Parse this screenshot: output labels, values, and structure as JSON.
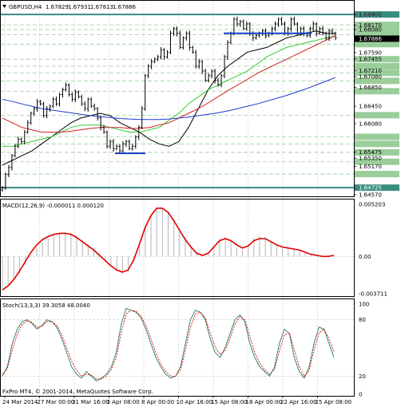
{
  "chart_data": [
    {
      "type": "line",
      "panel": "price",
      "header": {
        "symbol": "GBPUSD,H4",
        "open": "1.67829",
        "high": "1.67931",
        "low": "1.67813",
        "close": "1.67886"
      },
      "symbol_icon": "triangle-down-icon",
      "ylim": [
        1.6457,
        1.6864
      ],
      "price_ticks": [
        "1.68400",
        "1.68170",
        "1.68080",
        "1.67590",
        "1.67455",
        "1.67210",
        "1.67080",
        "1.66850",
        "1.66450",
        "1.66080",
        "1.65475",
        "1.65350",
        "1.65170",
        "1.64570"
      ],
      "highlighted_levels": [
        {
          "value": 1.684,
          "label": "1.68400",
          "color": "#3a8c7f"
        },
        {
          "value": 1.6818,
          "label": "",
          "color": "#9acd9a"
        },
        {
          "value": 1.6808,
          "label": "",
          "color": "#9acd9a"
        },
        {
          "value": 1.6797,
          "label": "",
          "color": "#9acd9a"
        },
        {
          "value": 1.6777,
          "label": "",
          "color": "#9acd9a"
        },
        {
          "value": 1.6745,
          "label": "",
          "color": "#9acd9a"
        },
        {
          "value": 1.673,
          "label": "",
          "color": "#9acd9a"
        },
        {
          "value": 1.6716,
          "label": "",
          "color": "#9acd9a"
        },
        {
          "value": 1.6699,
          "label": "",
          "color": "#9acd9a"
        },
        {
          "value": 1.6677,
          "label": "",
          "color": "#9acd9a"
        },
        {
          "value": 1.6626,
          "label": "",
          "color": "#9acd9a"
        },
        {
          "value": 1.658,
          "label": "",
          "color": "#9acd9a"
        },
        {
          "value": 1.6565,
          "label": "",
          "color": "#9acd9a"
        },
        {
          "value": 1.6547,
          "label": "",
          "color": "#9acd9a"
        },
        {
          "value": 1.6527,
          "label": "",
          "color": "#9acd9a"
        },
        {
          "value": 1.6501,
          "label": "",
          "color": "#9acd9a"
        },
        {
          "value": 1.6472,
          "label": "1.64725",
          "color": "#3a8c7f"
        }
      ],
      "current_price": {
        "value": 1.67886,
        "label": "1.67886"
      },
      "support_lines": [
        {
          "x_from": 118,
          "x_to": 140,
          "value": 1.6545
        },
        {
          "x_from": 254,
          "x_to": 348,
          "value": 1.68
        }
      ],
      "close_series": [
        1.6472,
        1.65,
        1.6515,
        1.654,
        1.656,
        1.6575,
        1.657,
        1.659,
        1.661,
        1.663,
        1.664,
        1.6655,
        1.665,
        1.6625,
        1.664,
        1.6645,
        1.666,
        1.665,
        1.667,
        1.668,
        1.669,
        1.667,
        1.666,
        1.6675,
        1.6665,
        1.665,
        1.664,
        1.666,
        1.6645,
        1.664,
        1.662,
        1.66,
        1.659,
        1.656,
        1.657,
        1.6555,
        1.656,
        1.655,
        1.6565,
        1.657,
        1.6555,
        1.656,
        1.658,
        1.66,
        1.664,
        1.671,
        1.673,
        1.674,
        1.6745,
        1.675,
        1.6765,
        1.675,
        1.676,
        1.68,
        1.681,
        1.68,
        1.677,
        1.679,
        1.68,
        1.677,
        1.676,
        1.673,
        1.674,
        1.672,
        1.67,
        1.671,
        1.672,
        1.67,
        1.669,
        1.671,
        1.675,
        1.678,
        1.68,
        1.683,
        1.682,
        1.6825,
        1.681,
        1.682,
        1.68,
        1.679,
        1.6795,
        1.68,
        1.6805,
        1.6795,
        1.68,
        1.681,
        1.682,
        1.683,
        1.682,
        1.68,
        1.681,
        1.683,
        1.682,
        1.68,
        1.681,
        1.68,
        1.6795,
        1.681,
        1.682,
        1.68,
        1.681,
        1.68,
        1.679,
        1.6805,
        1.68,
        1.679
      ],
      "ma_series": [
        {
          "color": "#000000",
          "values": [
            1.652,
            1.653,
            1.654,
            1.655,
            1.6565,
            1.658,
            1.6595,
            1.661,
            1.662,
            1.6625,
            1.663,
            1.6625,
            1.661,
            1.66,
            1.659,
            1.6575,
            1.6565,
            1.656,
            1.657,
            1.66,
            1.664,
            1.668,
            1.671,
            1.673,
            1.6745,
            1.676,
            1.6765,
            1.677,
            1.678,
            1.679,
            1.6795,
            1.68,
            1.6805,
            1.68,
            1.68
          ]
        },
        {
          "color": "#33cc33",
          "values": [
            1.656,
            1.656,
            1.6565,
            1.657,
            1.6575,
            1.658,
            1.659,
            1.66,
            1.6605,
            1.6605,
            1.6605,
            1.66,
            1.6595,
            1.659,
            1.659,
            1.6595,
            1.66,
            1.6615,
            1.663,
            1.665,
            1.6665,
            1.668,
            1.669,
            1.67,
            1.671,
            1.672,
            1.6735,
            1.675,
            1.676,
            1.677,
            1.6775,
            1.678,
            1.6785,
            1.679,
            1.6795
          ]
        },
        {
          "color": "#d02020",
          "values": [
            1.662,
            1.661,
            1.66,
            1.6595,
            1.659,
            1.659,
            1.659,
            1.6592,
            1.6595,
            1.6598,
            1.66,
            1.66,
            1.66,
            1.6598,
            1.6598,
            1.66,
            1.6605,
            1.661,
            1.662,
            1.663,
            1.664,
            1.6652,
            1.6665,
            1.6678,
            1.669,
            1.6702,
            1.6715,
            1.6725,
            1.6735,
            1.6745,
            1.6755,
            1.6765,
            1.6775,
            1.6785,
            1.6795
          ]
        },
        {
          "color": "#1a3ccf",
          "values": [
            1.666,
            1.6655,
            1.665,
            1.6645,
            1.664,
            1.6637,
            1.6634,
            1.6631,
            1.6628,
            1.6625,
            1.6623,
            1.6621,
            1.6619,
            1.6618,
            1.6617,
            1.6617,
            1.6617,
            1.6618,
            1.662,
            1.6622,
            1.6625,
            1.6628,
            1.6631,
            1.6635,
            1.664,
            1.6645,
            1.665,
            1.6656,
            1.6662,
            1.6668,
            1.6675,
            1.6682,
            1.669,
            1.6698,
            1.6706
          ]
        }
      ]
    },
    {
      "type": "bar",
      "panel": "macd",
      "title": "MACD(12,26,9) -0.000011 0.000120",
      "ylim": [
        -0.00371,
        0.00528
      ],
      "ticks": [
        "0.005203",
        "0.00",
        "-0.003711"
      ],
      "histogram": [
        -0.003,
        -0.0027,
        -0.0022,
        -0.0016,
        -0.0008,
        0.0,
        0.0008,
        0.0014,
        0.0018,
        0.002,
        0.0022,
        0.0023,
        0.0022,
        0.002,
        0.0016,
        0.0012,
        0.0008,
        0.0003,
        -0.0003,
        -0.0008,
        -0.0013,
        -0.0016,
        -0.0015,
        -0.0005,
        0.001,
        0.0028,
        0.004,
        0.0046,
        0.0047,
        0.0043,
        0.0036,
        0.0027,
        0.0018,
        0.001,
        0.0004,
        0.0001,
        0.0003,
        0.001,
        0.0017,
        0.0019,
        0.0014,
        0.0008,
        0.0006,
        0.0012,
        0.0018,
        0.002,
        0.0019,
        0.0015,
        0.001,
        0.0008,
        0.0007,
        0.0008,
        0.0006,
        0.0004,
        0.0002,
        0.0001,
        0.0,
        -0.0001,
        0.0
      ],
      "signal": [
        -0.0032,
        -0.0028,
        -0.0022,
        -0.0014,
        -0.0005,
        0.0004,
        0.0011,
        0.0016,
        0.0019,
        0.0021,
        0.0022,
        0.0022,
        0.0021,
        0.0018,
        0.0014,
        0.001,
        0.0006,
        0.0001,
        -0.0004,
        -0.0009,
        -0.0013,
        -0.0015,
        -0.0013,
        -0.0003,
        0.0012,
        0.0028,
        0.0039,
        0.0046,
        0.0046,
        0.0042,
        0.0034,
        0.0025,
        0.0016,
        0.0009,
        0.0003,
        0.0001,
        0.0003,
        0.0009,
        0.0015,
        0.0017,
        0.0015,
        0.0011,
        0.0008,
        0.001,
        0.0015,
        0.0017,
        0.0017,
        0.0014,
        0.0011,
        0.0009,
        0.0008,
        0.0007,
        0.0006,
        0.0004,
        0.0002,
        0.0001,
        0.0,
        0.0,
        0.0001
      ]
    },
    {
      "type": "line",
      "panel": "stochastic",
      "title": "Stoch(13,3,3) 39.3058 48.0040",
      "ylim": [
        0,
        100
      ],
      "ticks": [
        "100",
        "80",
        "20",
        "0"
      ],
      "main": [
        20,
        30,
        55,
        70,
        78,
        80,
        76,
        70,
        74,
        80,
        78,
        72,
        60,
        45,
        30,
        22,
        18,
        25,
        20,
        15,
        18,
        22,
        30,
        45,
        75,
        92,
        90,
        88,
        82,
        70,
        55,
        40,
        30,
        22,
        18,
        20,
        30,
        55,
        80,
        90,
        88,
        80,
        60,
        45,
        40,
        50,
        65,
        80,
        85,
        78,
        55,
        40,
        30,
        25,
        20,
        30,
        55,
        70,
        65,
        40,
        25,
        18,
        30,
        55,
        72,
        70,
        55,
        40
      ],
      "signal": [
        22,
        28,
        48,
        65,
        75,
        79,
        77,
        72,
        73,
        78,
        78,
        74,
        64,
        50,
        36,
        26,
        20,
        22,
        21,
        17,
        17,
        20,
        27,
        40,
        66,
        86,
        90,
        89,
        84,
        74,
        60,
        45,
        33,
        25,
        20,
        20,
        27,
        48,
        72,
        86,
        88,
        82,
        66,
        51,
        43,
        47,
        60,
        75,
        83,
        80,
        62,
        45,
        34,
        27,
        22,
        27,
        47,
        64,
        66,
        48,
        30,
        20,
        26,
        48,
        66,
        70,
        60,
        46
      ]
    }
  ],
  "x_axis": {
    "labels": [
      "24 Mar 2014",
      "27 Mar 00:00",
      "31 Mar 16:00",
      "3 Apr 08:00",
      "8 Apr 00:00",
      "10 Apr 16:00",
      "15 Apr 08:00",
      "18 Apr 00:00",
      "22 Apr 16:00",
      "25 Apr 08:00"
    ]
  },
  "footer": {
    "copyright": "FxPro MT4, © 2001-2014, MetaQuotes Software Corp."
  },
  "colors": {
    "background": "#ffffff",
    "grid": "#c8c8c8",
    "candle": "#000000",
    "level_line": "#9acd9a",
    "level_major": "#3a8c7f",
    "support_line": "#1a3ccf",
    "macd_hist": "#b4b4b4",
    "macd_signal": "#e00000",
    "stoch_main": "#1e7d5a",
    "stoch_signal": "#e00000"
  }
}
